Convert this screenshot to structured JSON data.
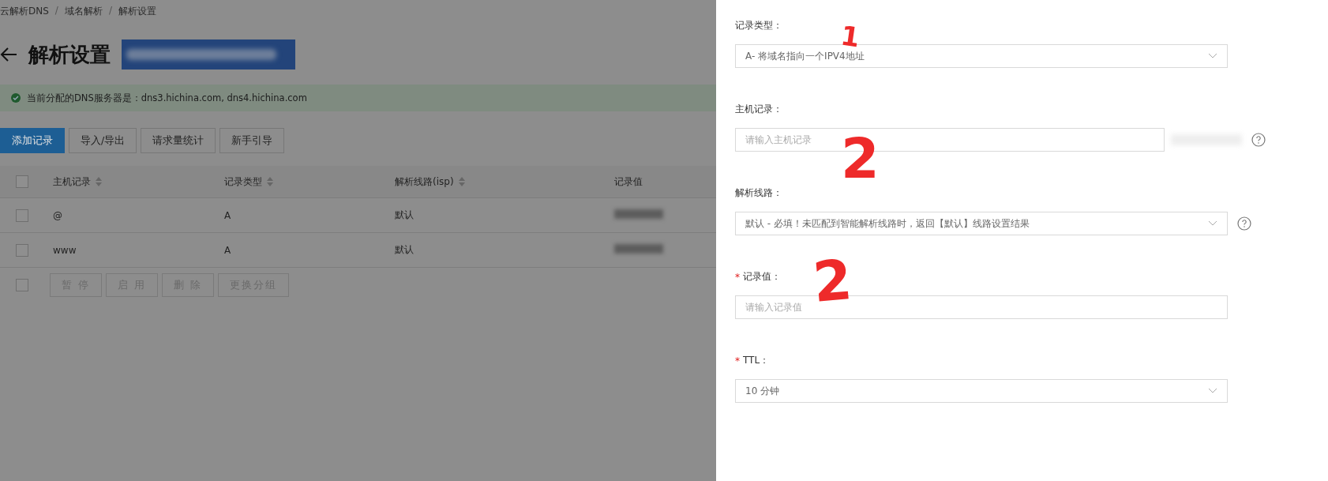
{
  "breadcrumb": [
    {
      "label": "云解析DNS"
    },
    {
      "separator": "/",
      "label": "域名解析"
    },
    {
      "separator": "/",
      "label": "解析设置"
    }
  ],
  "page_title": "解析设置",
  "notice": "当前分配的DNS服务器是：dns3.hichina.com, dns4.hichina.com",
  "toolbar": [
    {
      "label": "添加记录",
      "primary": true
    },
    {
      "label": "导入/导出",
      "primary": false
    },
    {
      "label": "请求量统计",
      "primary": false
    },
    {
      "label": "新手引导",
      "primary": false
    }
  ],
  "table": {
    "columns": [
      {
        "label": "主机记录",
        "sortable": true
      },
      {
        "label": "记录类型",
        "sortable": true
      },
      {
        "label": "解析线路(isp)",
        "sortable": true
      },
      {
        "label": "记录值",
        "sortable": false
      }
    ],
    "header_checked": false,
    "rows": [
      {
        "cells": [
          "@",
          "A",
          "默认"
        ],
        "checked": false
      },
      {
        "cells": [
          "www",
          "A",
          "默认"
        ],
        "checked": false
      }
    ]
  },
  "batch_checked": false,
  "batch_actions": [
    {
      "label": "暂 停",
      "disabled": true
    },
    {
      "label": "启 用",
      "disabled": true
    },
    {
      "label": "删 除",
      "disabled": true
    },
    {
      "label": "更换分组",
      "disabled": true
    }
  ],
  "form": [
    {
      "kind": "select",
      "label": "记录类型：",
      "value": "A- 将域名指向一个IPV4地址"
    },
    {
      "kind": "input",
      "label": "主机记录：",
      "placeholder": "请输入主机记录",
      "suffix": true,
      "help": true
    },
    {
      "kind": "select",
      "label": "解析线路：",
      "value": "默认 - 必填！未匹配到智能解析线路时，返回【默认】线路设置结果",
      "help": true
    },
    {
      "kind": "input",
      "required_mark": "*",
      "label": "记录值：",
      "placeholder": "请输入记录值"
    },
    {
      "kind": "select",
      "required_mark": "*",
      "label": "TTL：",
      "value": "10 分钟"
    }
  ],
  "annotations": [
    "1",
    "2",
    "2"
  ]
}
